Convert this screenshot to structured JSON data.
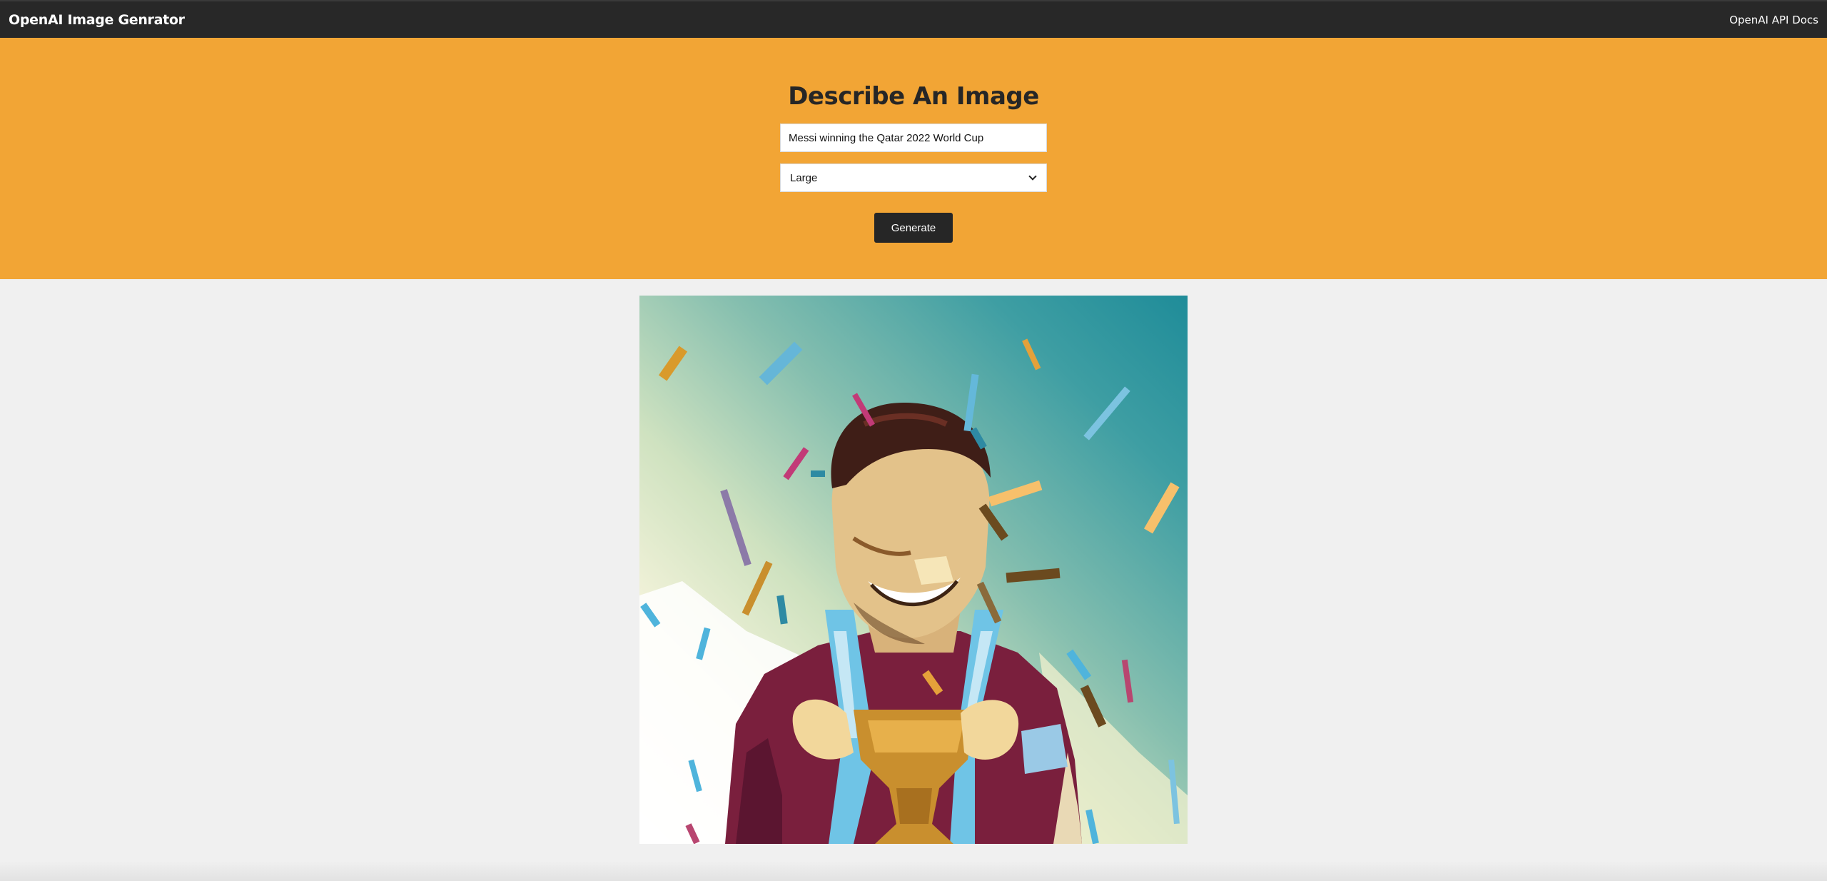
{
  "navbar": {
    "brand": "OpenAI Image Genrator",
    "docs_link": "OpenAI API Docs"
  },
  "form": {
    "title": "Describe An Image",
    "prompt_value": "Messi winning the Qatar 2022 World Cup",
    "size_selected": "Large",
    "generate_label": "Generate"
  },
  "colors": {
    "navbar": "#282828",
    "hero": "#f2a535",
    "button": "#262626",
    "page_bg": "#f0f0f0"
  },
  "icons": {
    "select_arrow": "chevron-down-icon"
  },
  "result": {
    "image_subject": "generated-image"
  }
}
